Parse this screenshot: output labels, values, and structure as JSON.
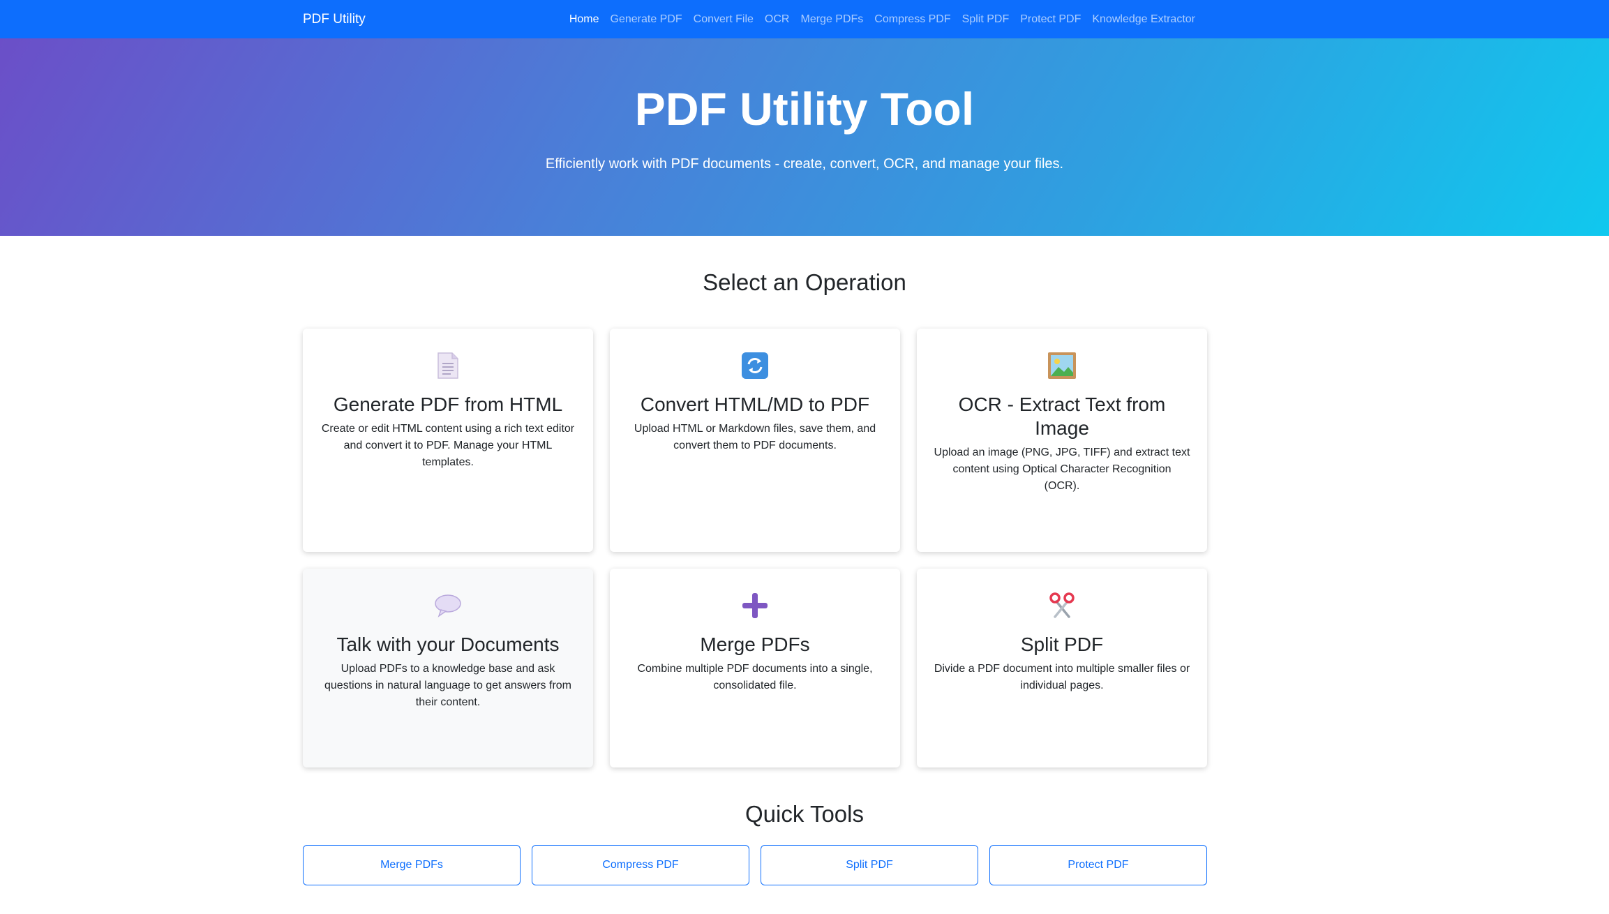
{
  "navbar": {
    "brand": "PDF Utility",
    "links": [
      {
        "label": "Home",
        "active": true
      },
      {
        "label": "Generate PDF"
      },
      {
        "label": "Convert File"
      },
      {
        "label": "OCR"
      },
      {
        "label": "Merge PDFs"
      },
      {
        "label": "Compress PDF"
      },
      {
        "label": "Split PDF"
      },
      {
        "label": "Protect PDF"
      },
      {
        "label": "Knowledge Extractor"
      }
    ]
  },
  "hero": {
    "title": "PDF Utility Tool",
    "subtitle": "Efficiently work with PDF documents - create, convert, OCR, and manage your files."
  },
  "operations": {
    "title": "Select an Operation",
    "cards": [
      {
        "icon": "document-icon",
        "title": "Generate PDF from HTML",
        "text": "Create or edit HTML content using a rich text editor and convert it to PDF. Manage your HTML templates."
      },
      {
        "icon": "refresh-icon",
        "title": "Convert HTML/MD to PDF",
        "text": "Upload HTML or Markdown files, save them, and convert them to PDF documents."
      },
      {
        "icon": "picture-icon",
        "title": "OCR - Extract Text from Image",
        "text": "Upload an image (PNG, JPG, TIFF) and extract text content using Optical Character Recognition (OCR)."
      },
      {
        "icon": "speech-bubble-icon",
        "title": "Talk with your Documents",
        "text": "Upload PDFs to a knowledge base and ask questions in natural language to get answers from their content."
      },
      {
        "icon": "plus-icon",
        "title": "Merge PDFs",
        "text": "Combine multiple PDF documents into a single, consolidated file."
      },
      {
        "icon": "scissors-icon",
        "title": "Split PDF",
        "text": "Divide a PDF document into multiple smaller files or individual pages."
      }
    ]
  },
  "quick_tools": {
    "title": "Quick Tools",
    "buttons": [
      "Merge PDFs",
      "Compress PDF",
      "Split PDF",
      "Protect PDF"
    ]
  },
  "colors": {
    "primary": "#0d6efd",
    "hero_gradient_start": "#6b4fc8",
    "hero_gradient_end": "#10c8ee"
  }
}
